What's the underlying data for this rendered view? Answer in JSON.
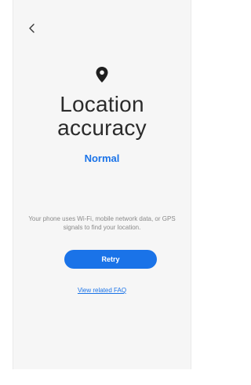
{
  "header": {
    "back_icon": "chevron-left-icon"
  },
  "main": {
    "icon": "location-pin-icon",
    "title": "Location accuracy",
    "accuracy_value": "Normal",
    "description": "Your phone uses Wi-Fi, mobile network data, or GPS signals to find your location.",
    "retry_label": "Retry",
    "faq_link": "View related FAQ"
  },
  "colors": {
    "accent": "#1a73e8",
    "background": "#f6f6f6",
    "title_text": "#2b2b2b",
    "secondary_text": "#8a8a8a"
  }
}
